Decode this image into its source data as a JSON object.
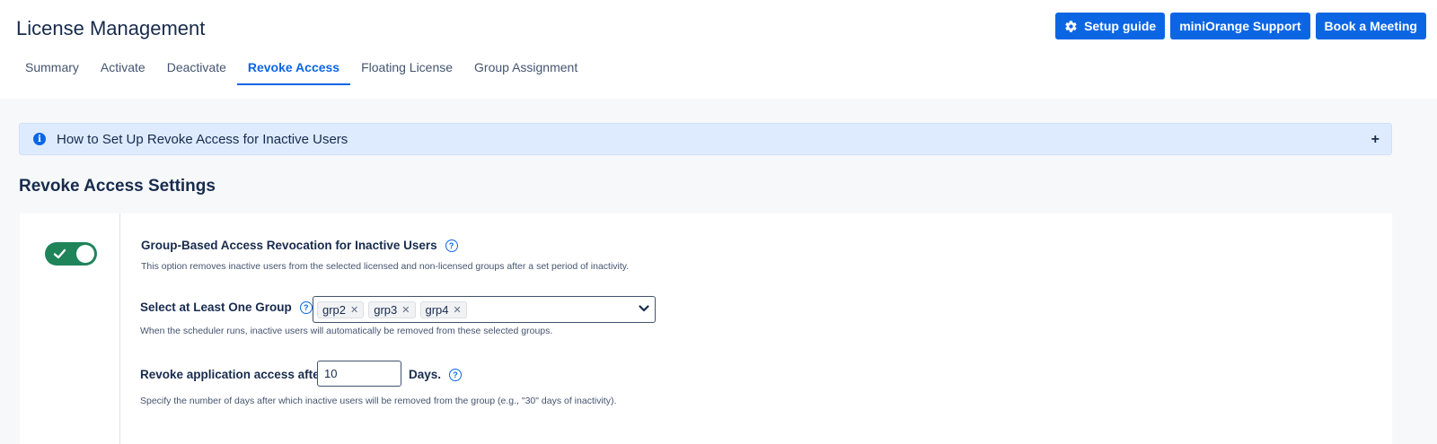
{
  "header": {
    "title": "License Management",
    "buttons": {
      "setup_guide": "Setup guide",
      "support": "miniOrange Support",
      "meeting": "Book a Meeting"
    }
  },
  "tabs": [
    {
      "label": "Summary",
      "active": false
    },
    {
      "label": "Activate",
      "active": false
    },
    {
      "label": "Deactivate",
      "active": false
    },
    {
      "label": "Revoke Access",
      "active": true
    },
    {
      "label": "Floating License",
      "active": false
    },
    {
      "label": "Group Assignment",
      "active": false
    }
  ],
  "info_bar": {
    "text": "How to Set Up Revoke Access for Inactive Users",
    "expand_symbol": "+"
  },
  "section": {
    "title": "Revoke Access Settings"
  },
  "settings": {
    "toggle_on": true,
    "option_title": "Group-Based Access Revocation for Inactive Users",
    "option_desc": "This option removes inactive users from the selected licensed and non-licensed groups after a set period of inactivity.",
    "group_label": "Select at Least One Group",
    "groups": [
      "grp2",
      "grp3",
      "grp4"
    ],
    "group_help": "When the scheduler runs, inactive users will automatically be removed from these selected groups.",
    "revoke_label": "Revoke application access after",
    "days_value": "10",
    "days_unit": "Days.",
    "revoke_help": "Specify the number of days after which inactive users will be removed from the group (e.g., \"30\" days of inactivity)."
  },
  "colors": {
    "primary": "#0c66e4",
    "toggle_on": "#1f845a",
    "info_bg": "#deebff"
  },
  "icons": {
    "setup_button": "gear-icon",
    "info": "info-icon",
    "help": "question-circle-icon",
    "dropdown": "chevron-down-icon",
    "toggle": "check-icon"
  }
}
